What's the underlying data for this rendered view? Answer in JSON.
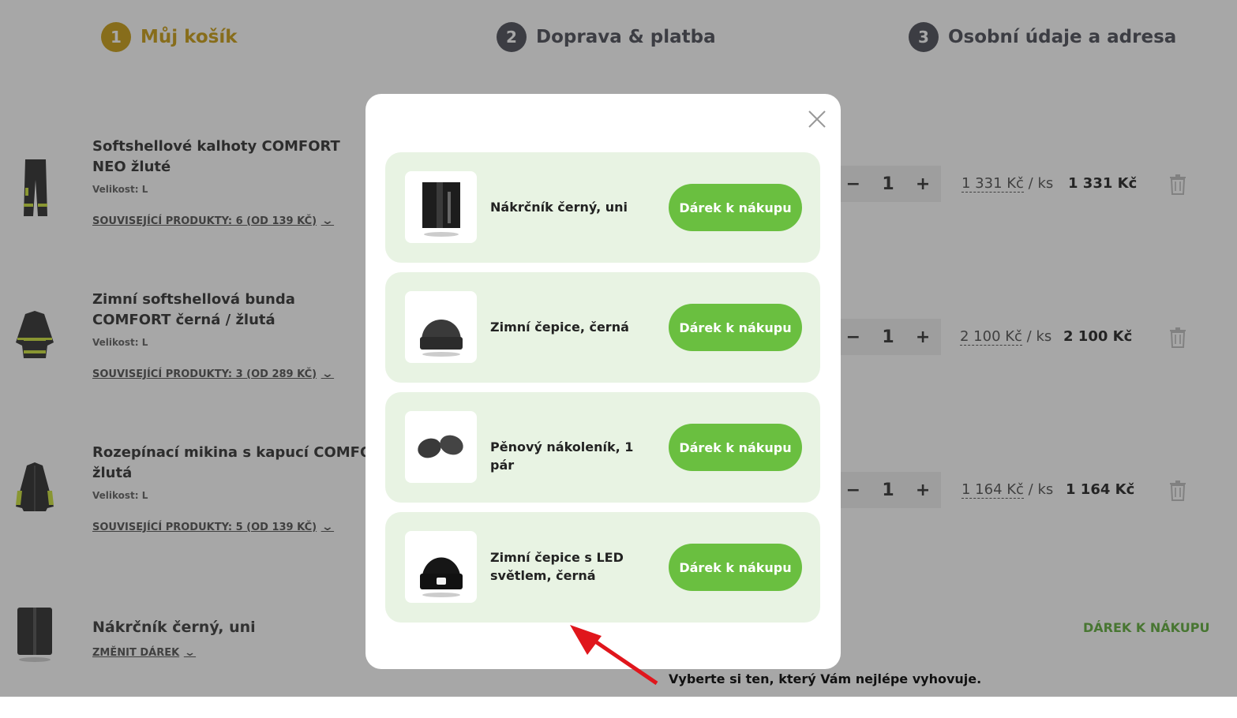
{
  "steps": [
    {
      "num": "1",
      "label": "Můj košík"
    },
    {
      "num": "2",
      "label": "Doprava & platba"
    },
    {
      "num": "3",
      "label": "Osobní údaje a adresa"
    }
  ],
  "cart": {
    "items": [
      {
        "title": "Softshellové kalhoty COMFORT NEO žluté",
        "size": "Velikost: L",
        "related": "SOUVISEJÍCÍ PRODUKTY: 6 (OD 139 KČ)",
        "qty": "1",
        "unit_price": "1 331 Kč",
        "unit_suffix": " / ks",
        "total": "1 331 Kč"
      },
      {
        "title": "Zimní softshellová bunda COMFORT černá / žlutá",
        "size": "Velikost: L",
        "related": "SOUVISEJÍCÍ PRODUKTY: 3 (OD 289 KČ)",
        "qty": "1",
        "unit_price": "2 100 Kč",
        "unit_suffix": " / ks",
        "total": "2 100 Kč"
      },
      {
        "title": "Rozepínací mikina s kapucí COMFO žlutá",
        "size": "Velikost: L",
        "related": "SOUVISEJÍCÍ PRODUKTY: 5 (OD 139 KČ)",
        "qty": "1",
        "unit_price": "1 164 Kč",
        "unit_suffix": " / ks",
        "total": "1 164 Kč"
      }
    ],
    "qty_minus": "−",
    "qty_plus": "+",
    "gift_item": {
      "title": "Nákrčník černý, uni",
      "change_label": "ZMĚNIT DÁREK",
      "badge": "DÁREK K NÁKUPU"
    }
  },
  "modal": {
    "gifts": [
      {
        "name": "Nákrčník černý, uni",
        "button": "Dárek k nákupu"
      },
      {
        "name": "Zimní čepice, černá",
        "button": "Dárek k nákupu"
      },
      {
        "name": "Pěnový nákoleník, 1 pár",
        "button": "Dárek k nákupu"
      },
      {
        "name": "Zimní čepice s LED světlem, černá",
        "button": "Dárek k nákupu"
      }
    ]
  },
  "annotation": "Vyberte si ten, který Vám nejlépe vyhovuje.",
  "colors": {
    "accent": "#c59500",
    "green": "#6abf40",
    "card_bg": "#e8f3e3",
    "arrow": "#e0161c"
  }
}
